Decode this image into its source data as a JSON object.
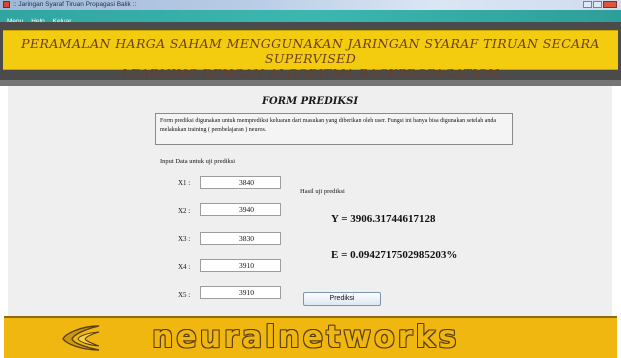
{
  "window": {
    "title": ":: Jaringan Syaraf Tiruan Propagasi Balik ::"
  },
  "menu": {
    "items": [
      "Menu",
      "Help",
      "Keluar"
    ]
  },
  "header": {
    "title_line1": "PERAMALAN HARGA SAHAM MENGGUNAKAN JARINGAN SYARAF TIRUAN SECARA SUPERVISED",
    "title_line2": "LEARNING DENGAN ALGORITMA BACKPROPAGATION"
  },
  "form": {
    "title": "FORM PREDIKSI",
    "description": "Form prediksi digunakan untuk memprediksi keluaran dari masukan yang diberikan oleh user. Fungsi ini hanya bisa digunakan setelah anda melakukan training ( pembelajaran ) neuros.",
    "input_label": "Input Data untuk uji prediksi",
    "inputs": [
      {
        "label": "X1 :",
        "value": "3840"
      },
      {
        "label": "X2 :",
        "value": "3940"
      },
      {
        "label": "X3 :",
        "value": "3830"
      },
      {
        "label": "X4 :",
        "value": "3910"
      },
      {
        "label": "X5 :",
        "value": "3910"
      }
    ],
    "result_label": "Hasil uji prediksi",
    "y_result": "Y = 3906.31744617128",
    "e_result": "E = 0.0942717502985203%",
    "button_label": "Prediksi"
  },
  "footer": {
    "logo_text": "neuralnetworks"
  },
  "colors": {
    "banner": "#f3cc0f",
    "header_text": "#6b3f22",
    "menubar": "#3cb7b0",
    "footer": "#efb70f",
    "panel": "#efefef"
  }
}
